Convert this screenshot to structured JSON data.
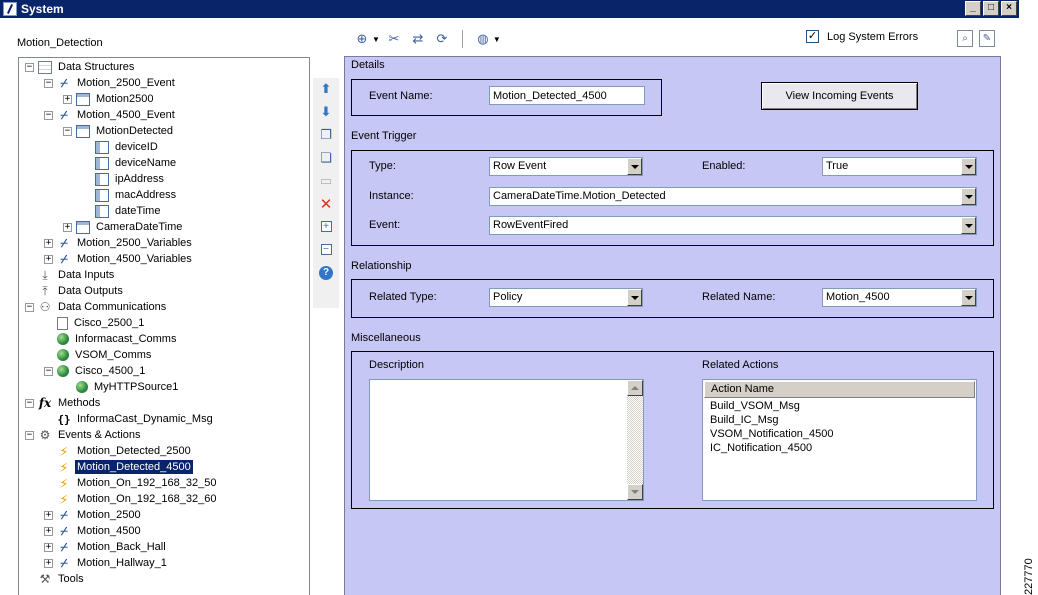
{
  "window": {
    "title": "System",
    "minimize": "_",
    "maximize": "□",
    "close": "×"
  },
  "root_label": "Motion_Detection",
  "tree": [
    {
      "label": "Data Structures",
      "icon": "structure-icon",
      "expander": "−",
      "depth": 0
    },
    {
      "label": "Motion_2500_Event",
      "icon": "event-icon",
      "expander": "−",
      "depth": 1
    },
    {
      "label": "Motion2500",
      "icon": "table-icon",
      "expander": "+",
      "depth": 2
    },
    {
      "label": "Motion_4500_Event",
      "icon": "event-icon",
      "expander": "−",
      "depth": 1
    },
    {
      "label": "MotionDetected",
      "icon": "table-icon",
      "expander": "−",
      "depth": 2
    },
    {
      "label": "deviceID",
      "icon": "field-icon",
      "expander": "",
      "depth": 3
    },
    {
      "label": "deviceName",
      "icon": "field-icon",
      "expander": "",
      "depth": 3
    },
    {
      "label": "ipAddress",
      "icon": "field-icon",
      "expander": "",
      "depth": 3
    },
    {
      "label": "macAddress",
      "icon": "field-icon",
      "expander": "",
      "depth": 3
    },
    {
      "label": "dateTime",
      "icon": "field-icon",
      "expander": "",
      "depth": 3
    },
    {
      "label": "CameraDateTime",
      "icon": "table-icon",
      "expander": "+",
      "depth": 2
    },
    {
      "label": "Motion_2500_Variables",
      "icon": "variable-icon",
      "expander": "+",
      "depth": 1
    },
    {
      "label": "Motion_4500_Variables",
      "icon": "variable-icon",
      "expander": "+",
      "depth": 1
    },
    {
      "label": "Data Inputs",
      "icon": "input-icon",
      "expander": "",
      "depth": 0
    },
    {
      "label": "Data Outputs",
      "icon": "output-icon",
      "expander": "",
      "depth": 0
    },
    {
      "label": "Data Communications",
      "icon": "network-icon",
      "expander": "−",
      "depth": 0
    },
    {
      "label": "Cisco_2500_1",
      "icon": "document-icon",
      "expander": "",
      "depth": 1
    },
    {
      "label": "Informacast_Comms",
      "icon": "globe-icon",
      "expander": "",
      "depth": 1
    },
    {
      "label": "VSOM_Comms",
      "icon": "globe-icon",
      "expander": "",
      "depth": 1
    },
    {
      "label": "Cisco_4500_1",
      "icon": "globe-icon",
      "expander": "−",
      "depth": 1
    },
    {
      "label": "MyHTTPSource1",
      "icon": "globe-icon",
      "expander": "",
      "depth": 2
    },
    {
      "label": "Methods",
      "icon": "function-icon",
      "expander": "−",
      "depth": 0
    },
    {
      "label": "InformaCast_Dynamic_Msg",
      "icon": "braces-icon",
      "expander": "",
      "depth": 1
    },
    {
      "label": "Events & Actions",
      "icon": "gears-icon",
      "expander": "−",
      "depth": 0
    },
    {
      "label": "Motion_Detected_2500",
      "icon": "bolt-icon",
      "expander": "",
      "depth": 1
    },
    {
      "label": "Motion_Detected_4500",
      "icon": "bolt-icon",
      "expander": "",
      "depth": 1,
      "selected": true
    },
    {
      "label": "Motion_On_192_168_32_50",
      "icon": "bolt-icon",
      "expander": "",
      "depth": 1
    },
    {
      "label": "Motion_On_192_168_32_60",
      "icon": "bolt-icon",
      "expander": "",
      "depth": 1
    },
    {
      "label": "Motion_2500",
      "icon": "variable-icon",
      "expander": "+",
      "depth": 1
    },
    {
      "label": "Motion_4500",
      "icon": "variable-icon",
      "expander": "+",
      "depth": 1
    },
    {
      "label": "Motion_Back_Hall",
      "icon": "variable-icon",
      "expander": "+",
      "depth": 1
    },
    {
      "label": "Motion_Hallway_1",
      "icon": "variable-icon",
      "expander": "+",
      "depth": 1
    },
    {
      "label": "Tools",
      "icon": "tools-icon",
      "expander": "",
      "depth": 0
    }
  ],
  "toolbar": {
    "log_errors_label": "Log System Errors",
    "log_errors_checked": "✓"
  },
  "details": {
    "section_title": "Details",
    "event_name_label": "Event Name:",
    "event_name_value": "Motion_Detected_4500",
    "view_events_button": "View Incoming Events"
  },
  "trigger": {
    "section_title": "Event Trigger",
    "type_label": "Type:",
    "type_value": "Row Event",
    "enabled_label": "Enabled:",
    "enabled_value": "True",
    "instance_label": "Instance:",
    "instance_value": "CameraDateTime.Motion_Detected",
    "event_label": "Event:",
    "event_value": "RowEventFired"
  },
  "relationship": {
    "section_title": "Relationship",
    "related_type_label": "Related Type:",
    "related_type_value": "Policy",
    "related_name_label": "Related Name:",
    "related_name_value": "Motion_4500"
  },
  "misc": {
    "section_title": "Miscellaneous",
    "description_label": "Description",
    "description_value": "",
    "related_actions_label": "Related Actions",
    "actions_header": "Action Name",
    "actions": [
      "Build_VSOM_Msg",
      "Build_IC_Msg",
      "VSOM_Notification_4500",
      "IC_Notification_4500"
    ]
  },
  "figure_number": "227770",
  "colors": {
    "panel_bg": "#c7c7f5",
    "title_bar": "#0a246a",
    "selection": "#0a246a"
  }
}
